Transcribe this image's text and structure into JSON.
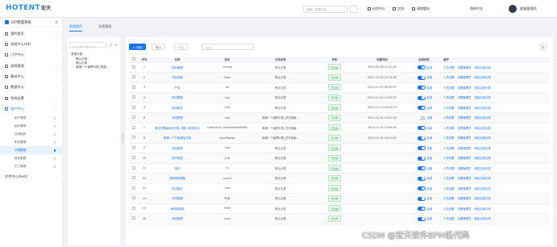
{
  "header": {
    "logo": "HOTENT",
    "logo_cn": "宏天",
    "search_placeholder": "请输入搜索内容",
    "app_center": "应用中心",
    "desktop": "文档",
    "clear_cache": "清除缓存",
    "language": "简体中文",
    "user": "超级管理员"
  },
  "sidebar": {
    "title": "EIP管理系统",
    "toggle": "≡",
    "items": [
      {
        "label": "我的首页",
        "arrow": "›"
      },
      {
        "label": "流程中心(44)",
        "arrow": "›"
      },
      {
        "label": "门户中心",
        "arrow": "›"
      },
      {
        "label": "流程管理",
        "arrow": "›"
      },
      {
        "label": "集成中心",
        "arrow": "›"
      },
      {
        "label": "数据中心",
        "arrow": "›"
      },
      {
        "label": "系统设置",
        "arrow": "›"
      },
      {
        "label": "用户中心",
        "arrow": "⌄"
      }
    ],
    "subitems": [
      "用户管理",
      "组织管理",
      "应用组织",
      "职位管理",
      "分类管理",
      "角色管理",
      "员工管理"
    ],
    "footer": {
      "label": "文件中心(test)",
      "arrow": "›"
    }
  },
  "tabs": [
    "系统首页",
    "分类管理"
  ],
  "tree": {
    "search_placeholder": "输入关键字进行过滤",
    "expand_icon": "⤢",
    "collapse_icon": "≡",
    "nodes": [
      "表单分类",
      "默认分类",
      "默认分类",
      "新增一个级联分类_新增..."
    ]
  },
  "toolbar": {
    "add": "添加",
    "import": "导入",
    "export": "导出",
    "search_placeholder": "搜索",
    "refresh": "↻"
  },
  "table": {
    "headers": [
      "序号",
      "名称",
      "别名",
      "分类名称",
      "状态",
      "创建时间",
      "启用状态",
      "操作"
    ],
    "status_label": "已生效",
    "switch_label": "启用",
    "ops": [
      "人员设置",
      "设置管理员",
      "绑定应用分类"
    ],
    "rows": [
      {
        "n": "1",
        "name": "项目管理",
        "alias": "xmmgl",
        "cat": "默认分类",
        "time": "2023-05-09 10:40:02",
        "on": true
      },
      {
        "n": "2",
        "name": "项目进度",
        "alias": "kuph",
        "cat": "默认分类",
        "time": "2021-10-26 10:14:56",
        "on": true
      },
      {
        "n": "3",
        "name": "产品",
        "alias": "cp",
        "cat": "默认分类",
        "time": "2023-11-09 09:49:57",
        "on": true
      },
      {
        "n": "4",
        "name": "测试图例",
        "alias": "csjz",
        "cat": "默认分类",
        "time": "2023-11-20 13:45:31",
        "on": true
      },
      {
        "n": "5",
        "name": "测试组件",
        "alias": "csji1",
        "cat": "默认分类",
        "time": "2023-12-13 16:43:19",
        "on": true
      },
      {
        "n": "6",
        "name": "测试数据",
        "alias": "csxj",
        "cat": "新增一个级联分类_在字段级...",
        "time": "2023-12-15 15:42:54",
        "on": false
      },
      {
        "n": "7",
        "name": "测试无限级树状分类_勿删 (测试批次)",
        "alias": "csjsfxlcmb_bcfkebrfafbxfsfbfs",
        "cat": "新增一个级联分类_在字段级...",
        "time": "2023-12-15 15:59:04",
        "on": true
      },
      {
        "n": "8",
        "name": "新增一个只能增加分类",
        "alias": "xzyjzfljqzgs",
        "cat": "新增一个级联分类_在字段级...",
        "time": "2023-12-15 16:20:02",
        "on": true
      },
      {
        "n": "9",
        "name": "测试推荐",
        "alias": "csjq",
        "cat": "默认分类",
        "time": "",
        "on": true
      },
      {
        "n": "10",
        "name": "用户权限",
        "alias": "yhjz",
        "cat": "默认分类",
        "time": "",
        "on": true
      },
      {
        "n": "11",
        "name": "测试",
        "alias": "cs",
        "cat": "默认分类",
        "time": "",
        "on": true
      },
      {
        "n": "12",
        "name": "流程审批模板",
        "alias": "jcpcrx",
        "cat": "默认分类",
        "time": "",
        "on": true
      },
      {
        "n": "13",
        "name": "测试组件",
        "alias": "csaz",
        "cat": "默认分类",
        "time": "",
        "on": true
      },
      {
        "n": "14",
        "name": "环境管理",
        "alias": "时间",
        "cat": "默认分类",
        "time": "",
        "on": true
      },
      {
        "n": "15",
        "name": "移动端权限",
        "alias": "9999",
        "cat": "默认分类",
        "time": "",
        "on": true
      },
      {
        "n": "16",
        "name": "测试管理",
        "alias": "xcyz",
        "cat": "默认分类",
        "time": "",
        "on": true
      }
    ]
  },
  "watermark": "CSDN @宏天软件BPM低代码"
}
